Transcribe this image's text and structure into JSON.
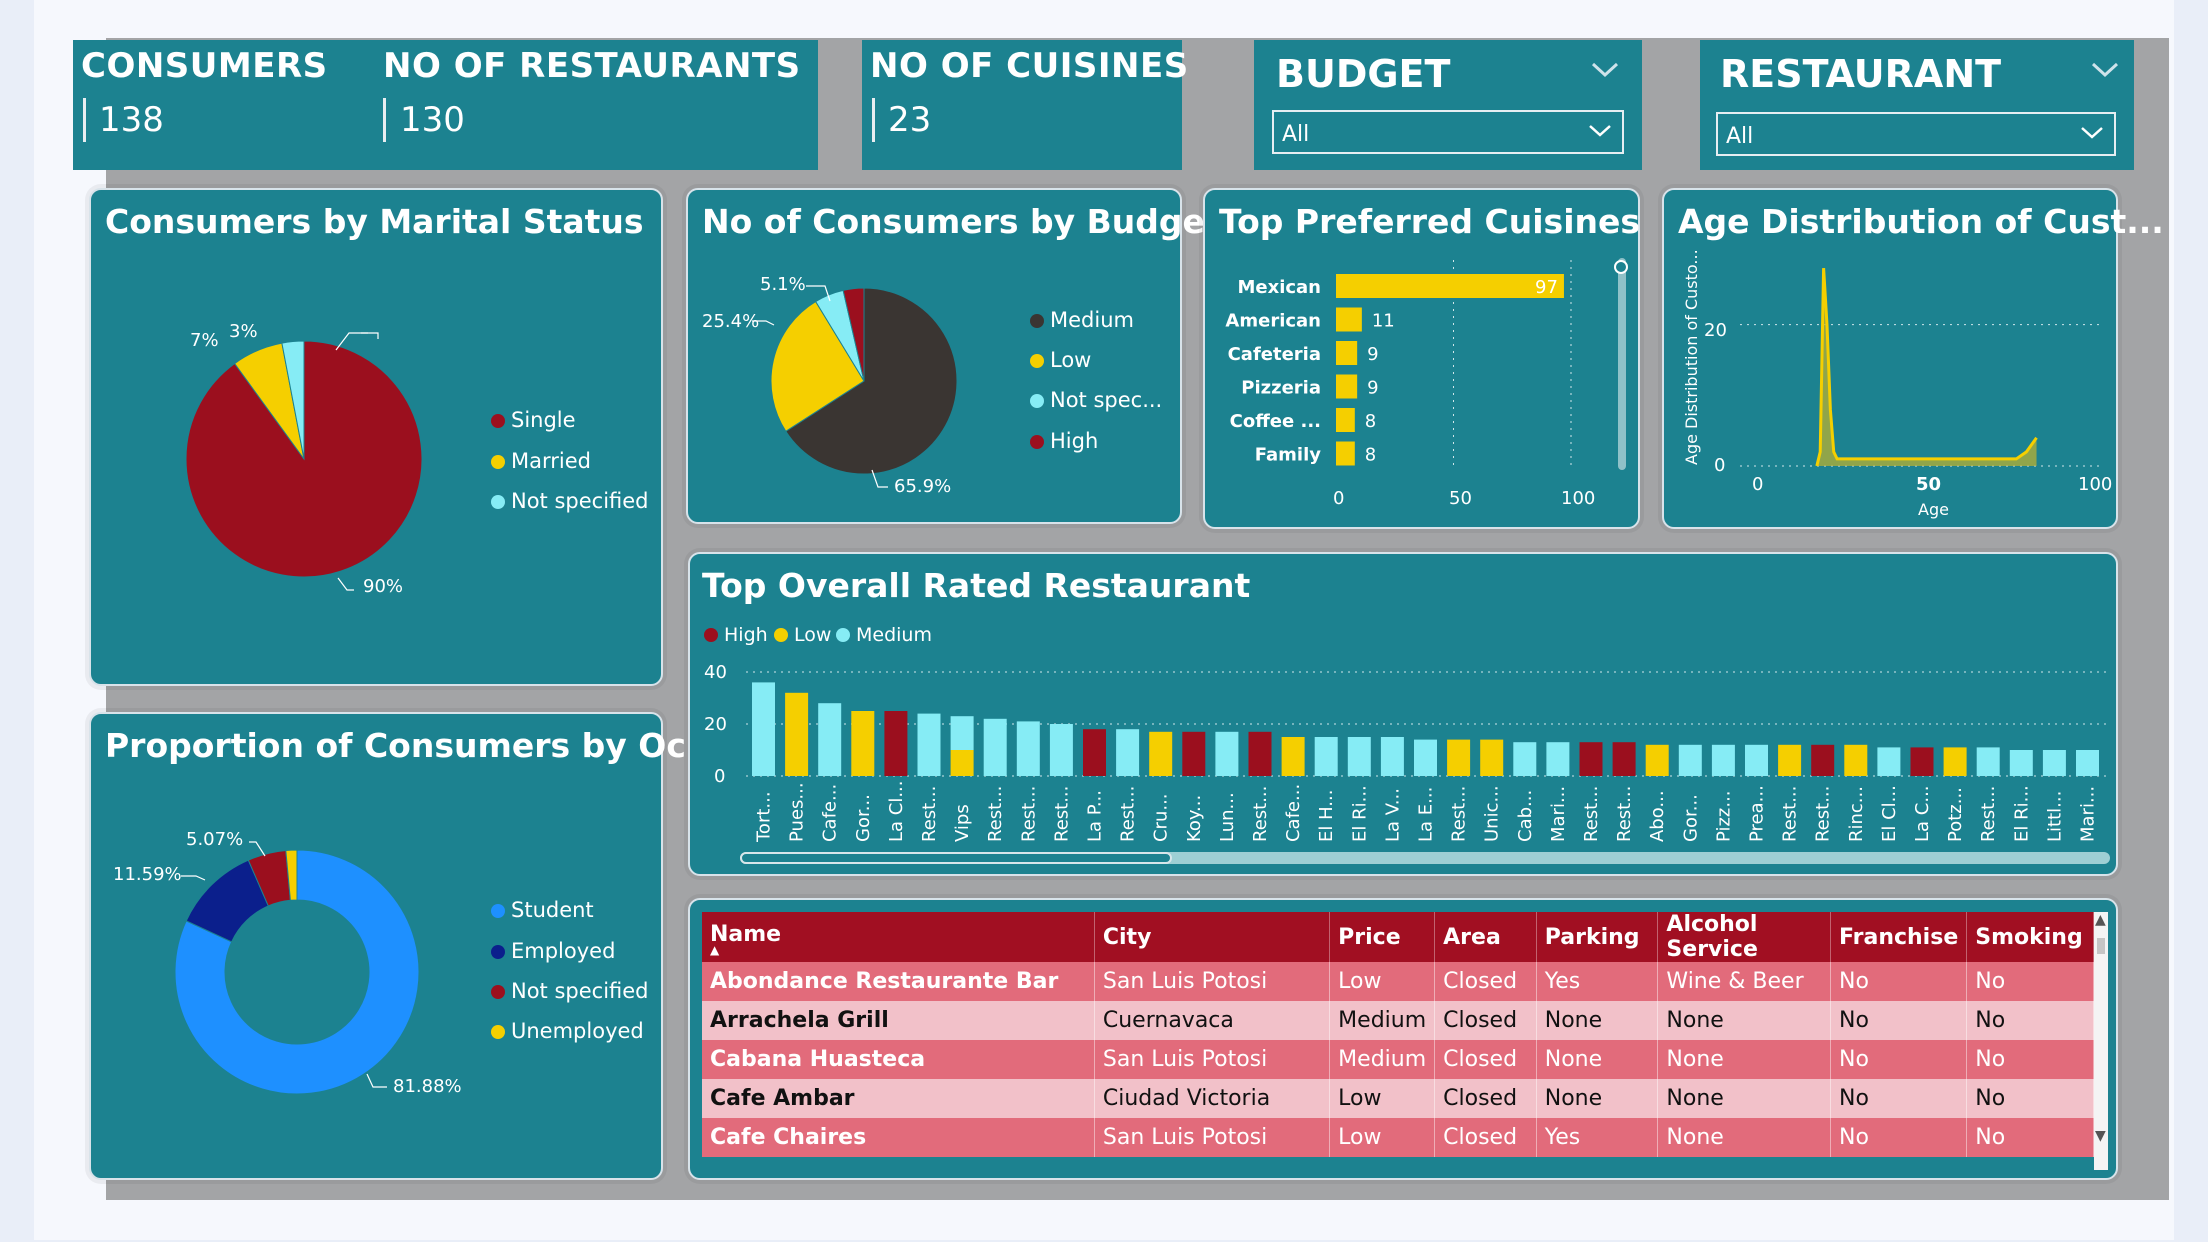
{
  "kpis": {
    "consumers": {
      "label": "CONSUMERS",
      "value": "138"
    },
    "restaurants": {
      "label": "NO OF RESTAURANTS",
      "value": "130"
    },
    "cuisines": {
      "label": "NO OF CUISINES",
      "value": "23"
    }
  },
  "slicers": {
    "budget": {
      "title": "BUDGET",
      "selected": "All"
    },
    "restaurant": {
      "title": "RESTAURANT",
      "selected": "All"
    }
  },
  "marital": {
    "title": "Consumers by Marital Status",
    "labels": {
      "single": "90%",
      "married": "7%",
      "not_specified": "3%"
    },
    "legend": [
      "Single",
      "Married",
      "Not specified"
    ]
  },
  "budget_pie": {
    "title": "No of Consumers by Budget",
    "labels": {
      "medium": "65.9%",
      "low": "25.4%",
      "not_spec": "5.1%"
    },
    "legend": [
      "Medium",
      "Low",
      "Not spec...",
      "High"
    ]
  },
  "cuisines": {
    "title": "Top Preferred Cuisines",
    "categories": [
      "Mexican",
      "American",
      "Cafeteria",
      "Pizzeria",
      "Coffee ...",
      "Family"
    ],
    "values": [
      "97",
      "11",
      "9",
      "9",
      "8",
      "8"
    ],
    "ticks": [
      "0",
      "50",
      "100"
    ]
  },
  "age": {
    "title": "Age Distribution of Cust...",
    "ylabel": "Age Distribution of Custo...",
    "xlabel": "Age",
    "yticks": [
      "20",
      "0"
    ],
    "xticks": [
      "0",
      "50",
      "100"
    ]
  },
  "occupation": {
    "title": "Proportion of Consumers by Oc...",
    "labels": {
      "student": "81.88%",
      "employed": "11.59%",
      "not_specified": "5.07%"
    },
    "legend": [
      "Student",
      "Employed",
      "Not specified",
      "Unemployed"
    ]
  },
  "rated": {
    "title": "Top Overall Rated Restaurant",
    "legend": [
      "High",
      "Low",
      "Medium"
    ],
    "yticks": [
      "40",
      "20",
      "0"
    ],
    "categories": [
      "Tort...",
      "Pues...",
      "Cafe...",
      "Gor...",
      "La Cl...",
      "Rest...",
      "Vips",
      "Rest...",
      "Rest...",
      "Rest...",
      "La P...",
      "Rest...",
      "Cru...",
      "Koy...",
      "Lun...",
      "Rest...",
      "Cafe...",
      "El H...",
      "El Ri...",
      "La V...",
      "La E...",
      "Rest...",
      "Unic...",
      "Cab...",
      "Mari...",
      "Rest...",
      "Rest...",
      "Abo...",
      "Gor...",
      "Pizz...",
      "Prea...",
      "Rest...",
      "Rest...",
      "Rinc...",
      "El Cl...",
      "La C...",
      "Potz...",
      "Rest...",
      "El Ri...",
      "Littl...",
      "Mari..."
    ]
  },
  "chart_data": [
    {
      "type": "pie",
      "title": "Consumers by Marital Status",
      "categories": [
        "Single",
        "Married",
        "Not specified"
      ],
      "values": [
        90,
        7,
        3
      ]
    },
    {
      "type": "pie",
      "title": "No of Consumers by Budget",
      "categories": [
        "Medium",
        "Low",
        "Not spec...",
        "High"
      ],
      "values": [
        65.9,
        25.4,
        5.1,
        3.6
      ]
    },
    {
      "type": "bar",
      "title": "Top Preferred Cuisines",
      "categories": [
        "Mexican",
        "American",
        "Cafeteria",
        "Pizzeria",
        "Coffee ...",
        "Family"
      ],
      "values": [
        97,
        11,
        9,
        9,
        8,
        8
      ],
      "xlim": [
        0,
        100
      ]
    },
    {
      "type": "area",
      "title": "Age Distribution of Cust...",
      "xlabel": "Age",
      "ylabel": "Age Distribution of Custo...",
      "x": [
        18,
        19,
        20,
        21,
        22,
        23,
        24,
        26,
        30,
        40,
        50,
        60,
        70,
        77,
        80,
        83
      ],
      "y": [
        0,
        2,
        28,
        20,
        8,
        2,
        1,
        1,
        1,
        1,
        1,
        1,
        1,
        1,
        2,
        4
      ],
      "xlim": [
        0,
        100
      ],
      "ylim": [
        0,
        30
      ]
    },
    {
      "type": "pie",
      "title": "Proportion of Consumers by Oc...",
      "categories": [
        "Student",
        "Employed",
        "Not specified",
        "Unemployed"
      ],
      "values": [
        81.88,
        11.59,
        5.07,
        1.46
      ]
    },
    {
      "type": "bar",
      "title": "Top Overall Rated Restaurant",
      "categories": [
        "Tort...",
        "Pues...",
        "Cafe...",
        "Gor...",
        "La Cl...",
        "Rest...",
        "Vips",
        "Rest...",
        "Rest...",
        "Rest...",
        "La P...",
        "Rest...",
        "Cru...",
        "Koy...",
        "Lun...",
        "Rest...",
        "Cafe...",
        "El H...",
        "El Ri...",
        "La V...",
        "La E...",
        "Rest...",
        "Unic...",
        "Cab...",
        "Mari...",
        "Rest...",
        "Rest...",
        "Abo...",
        "Gor...",
        "Pizz...",
        "Prea...",
        "Rest...",
        "Rest...",
        "Rinc...",
        "El Cl...",
        "La C...",
        "Potz...",
        "Rest...",
        "El Ri...",
        "Littl...",
        "Mari..."
      ],
      "series": [
        {
          "name": "High",
          "values": [
            0,
            0,
            0,
            0,
            25,
            0,
            0,
            0,
            0,
            0,
            18,
            0,
            0,
            17,
            0,
            17,
            0,
            0,
            0,
            0,
            0,
            0,
            0,
            0,
            0,
            13,
            13,
            0,
            0,
            0,
            0,
            0,
            12,
            0,
            0,
            11,
            0,
            0,
            0,
            0,
            0
          ]
        },
        {
          "name": "Low",
          "values": [
            0,
            32,
            0,
            25,
            0,
            0,
            10,
            0,
            0,
            0,
            0,
            0,
            17,
            0,
            0,
            0,
            15,
            0,
            0,
            0,
            0,
            14,
            14,
            0,
            0,
            0,
            0,
            12,
            0,
            0,
            0,
            12,
            0,
            12,
            0,
            0,
            11,
            0,
            0,
            0,
            0
          ]
        },
        {
          "name": "Medium",
          "values": [
            36,
            0,
            28,
            0,
            0,
            24,
            13,
            22,
            21,
            20,
            0,
            18,
            0,
            0,
            17,
            0,
            0,
            15,
            15,
            15,
            14,
            0,
            0,
            13,
            13,
            0,
            0,
            0,
            12,
            12,
            12,
            0,
            0,
            0,
            11,
            0,
            0,
            11,
            10,
            10,
            10
          ]
        }
      ],
      "ylim": [
        0,
        40
      ]
    }
  ],
  "table": {
    "columns": [
      "Name",
      "City",
      "Price",
      "Area",
      "Parking",
      "Alcohol Service",
      "Franchise",
      "Smoking"
    ],
    "rows": [
      [
        "Abondance Restaurante Bar",
        "San Luis Potosi",
        "Low",
        "Closed",
        "Yes",
        "Wine & Beer",
        "No",
        "No"
      ],
      [
        "Arrachela Grill",
        "Cuernavaca",
        "Medium",
        "Closed",
        "None",
        "None",
        "No",
        "No"
      ],
      [
        "Cabana Huasteca",
        "San Luis Potosi",
        "Medium",
        "Closed",
        "None",
        "None",
        "No",
        "No"
      ],
      [
        "Cafe Ambar",
        "Ciudad Victoria",
        "Low",
        "Closed",
        "None",
        "None",
        "No",
        "No"
      ],
      [
        "Cafe Chaires",
        "San Luis Potosi",
        "Low",
        "Closed",
        "Yes",
        "None",
        "No",
        "No"
      ]
    ]
  },
  "colors": {
    "teal": "#1c8290",
    "high": "#9b0f1e",
    "low": "#f5cf00",
    "medium": "#86ecf5",
    "dark": "#3a3532",
    "student": "#1e90ff",
    "employed": "#0b1f8c",
    "header_red": "#a10f22",
    "row_dark": "#e26b7b",
    "row_light": "#f2c1c9"
  }
}
